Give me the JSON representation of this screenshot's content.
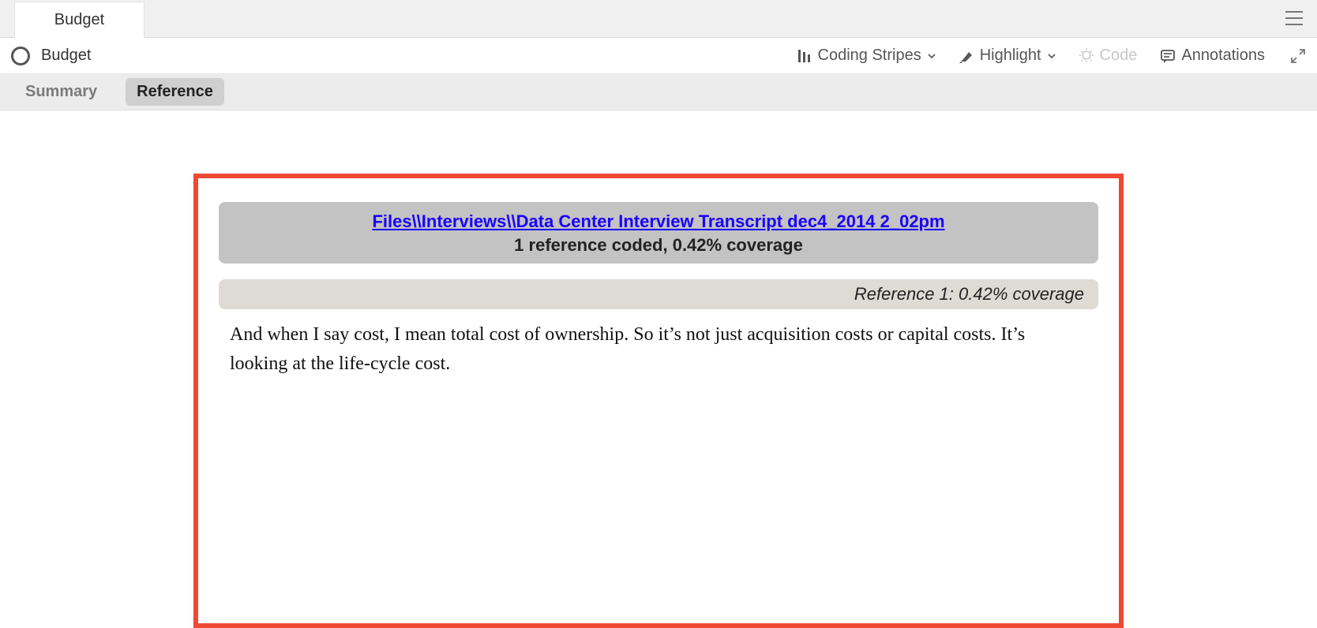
{
  "tab": {
    "label": "Budget"
  },
  "node": {
    "title": "Budget"
  },
  "toolbar": {
    "coding_stripes": "Coding Stripes",
    "highlight": "Highlight",
    "code": "Code",
    "annotations": "Annotations"
  },
  "subtabs": {
    "summary": "Summary",
    "reference": "Reference"
  },
  "reference": {
    "source_link": "Files\\\\Interviews\\\\Data Center Interview Transcript dec4_2014 2_02pm",
    "coverage_summary": "1 reference coded, 0.42% coverage",
    "items": [
      {
        "header": "Reference 1: 0.42% coverage",
        "text": "And when I say cost, I mean total cost of ownership.  So it’s not just acquisition costs or capital costs.  It’s looking at the life-cycle cost."
      }
    ]
  }
}
